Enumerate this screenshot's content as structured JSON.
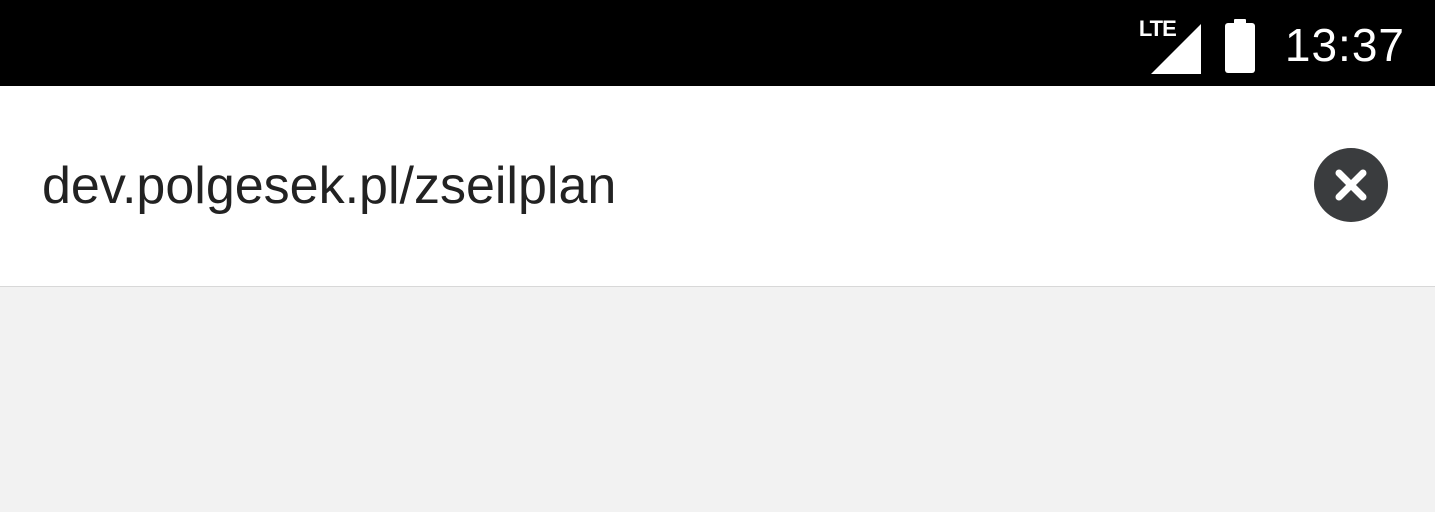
{
  "status_bar": {
    "network_label": "LTE",
    "network_icon": "cellular-signal-icon",
    "battery_icon": "battery-icon",
    "time": "13:37"
  },
  "address_bar": {
    "url": "dev.polgesek.pl/zseilplan",
    "clear_icon": "clear-circle-icon"
  },
  "colors": {
    "status_bar_bg": "#000000",
    "panel_bg": "#ffffff",
    "page_bg": "#f2f2f2",
    "clear_button_bg": "#3a3c3e",
    "url_text": "#222222"
  }
}
